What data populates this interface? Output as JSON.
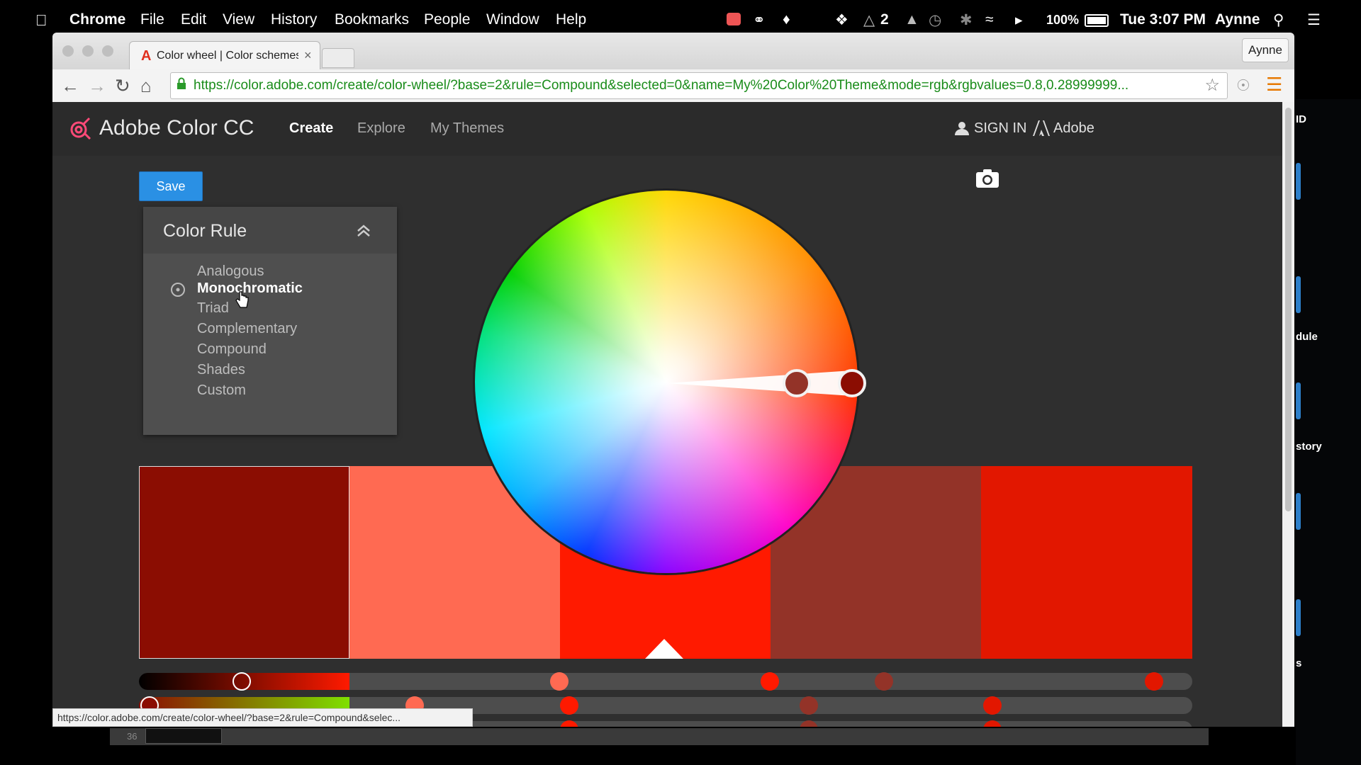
{
  "menubar": {
    "app": "Chrome",
    "items": [
      "File",
      "Edit",
      "View",
      "History",
      "Bookmarks",
      "People",
      "Window",
      "Help"
    ],
    "badge_count": "2",
    "battery": "100%",
    "clock": "Tue 3:07 PM",
    "user": "Aynne"
  },
  "browser": {
    "tab_title": "Color wheel | Color schemes",
    "profile": "Aynne",
    "url": "https://color.adobe.com/create/color-wheel/?base=2&rule=Compound&selected=0&name=My%20Color%20Theme&mode=rgb&rgbvalues=0.8,0.28999999...",
    "status_url": "https://color.adobe.com/create/color-wheel/?base=2&rule=Compound&selec..."
  },
  "app": {
    "brand": "Adobe Color CC",
    "nav": [
      "Create",
      "Explore",
      "My Themes"
    ],
    "sign_in": "SIGN IN",
    "adobe": "Adobe",
    "save_label": "Save"
  },
  "color_rule": {
    "title": "Color Rule",
    "options": [
      "Analogous",
      "Monochromatic",
      "Triad",
      "Complementary",
      "Compound",
      "Shades",
      "Custom"
    ],
    "selected": "Monochromatic"
  },
  "swatches": [
    "#8b0d02",
    "#ff6a52",
    "#ff1a00",
    "#933328",
    "#e21700"
  ],
  "colors": {
    "accent": "#2a90e4",
    "panel": "#4f4f4f",
    "background": "#2f2f2f"
  },
  "right_strip_labels": [
    "ID",
    "dule",
    "story",
    "s"
  ],
  "taskbar_number": "36"
}
